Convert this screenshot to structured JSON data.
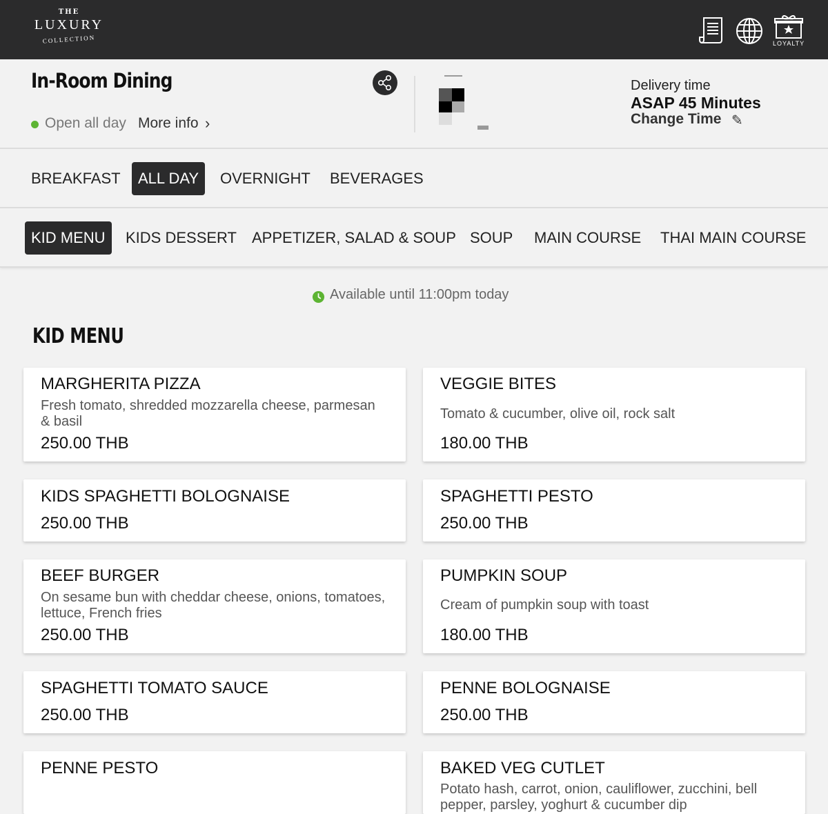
{
  "header": {
    "logo": {
      "the": "THE",
      "luxury": "LUXURY",
      "collection": "COLLECTION"
    },
    "icons": [
      {
        "name": "menu-scroll-icon"
      },
      {
        "name": "globe-icon"
      },
      {
        "name": "loyalty-icon",
        "label": "LOYALTY"
      }
    ]
  },
  "venue": {
    "title": "In-Room Dining",
    "status": "Open all day",
    "status_color": "#5db433",
    "more_info": "More info",
    "delivery_label": "Delivery time",
    "delivery_time": "ASAP 45 Minutes",
    "change_time": "Change Time"
  },
  "menu_tabs": [
    {
      "label": "BREAKFAST",
      "active": false
    },
    {
      "label": "ALL DAY",
      "active": true
    },
    {
      "label": "OVERNIGHT",
      "active": false
    },
    {
      "label": "BEVERAGES",
      "active": false
    }
  ],
  "category_tabs": [
    {
      "label": "KID MENU",
      "active": true
    },
    {
      "label": "KIDS DESSERT",
      "active": false
    },
    {
      "label": "APPETIZER, SALAD & SOUP",
      "active": false
    },
    {
      "label": "SOUP",
      "active": false
    },
    {
      "label": "MAIN COURSE",
      "active": false
    },
    {
      "label": "THAI MAIN COURSE",
      "active": false
    }
  ],
  "availability": "Available until 11:00pm today",
  "section_title": "KID MENU",
  "items": [
    {
      "name": "MARGHERITA PIZZA",
      "description": "Fresh tomato, shredded mozzarella cheese, parmesan & basil",
      "price": "250.00 THB"
    },
    {
      "name": "VEGGIE BITES",
      "description": "Tomato & cucumber, olive oil, rock salt",
      "price": "180.00 THB"
    },
    {
      "name": "KIDS SPAGHETTI BOLOGNAISE",
      "description": "",
      "price": "250.00 THB"
    },
    {
      "name": "SPAGHETTI PESTO",
      "description": "",
      "price": "250.00 THB"
    },
    {
      "name": "BEEF BURGER",
      "description": "On sesame bun with cheddar cheese, onions, tomatoes, lettuce, French fries",
      "price": "250.00 THB"
    },
    {
      "name": "PUMPKIN SOUP",
      "description": "Cream of pumpkin soup with toast",
      "price": "180.00 THB"
    },
    {
      "name": "SPAGHETTI TOMATO SAUCE",
      "description": "",
      "price": "250.00 THB"
    },
    {
      "name": "PENNE BOLOGNAISE",
      "description": "",
      "price": "250.00 THB"
    },
    {
      "name": "PENNE PESTO",
      "description": "",
      "price": ""
    },
    {
      "name": "BAKED VEG CUTLET",
      "description": "Potato hash, carrot, onion, cauliflower, zucchini, bell pepper, parsley, yoghurt & cucumber dip",
      "price": ""
    }
  ]
}
